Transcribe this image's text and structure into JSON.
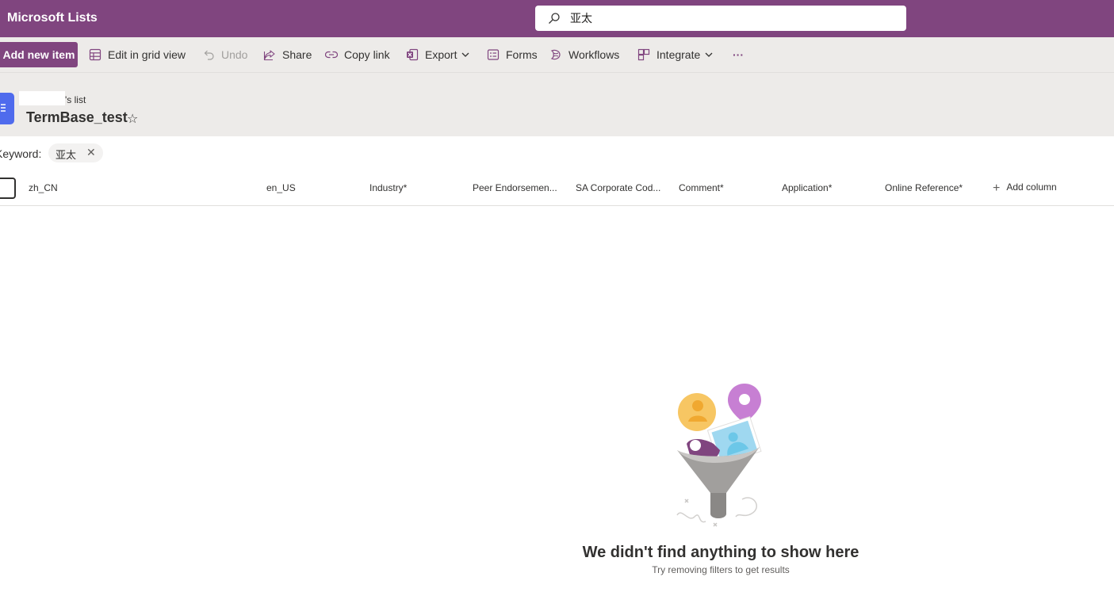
{
  "app": {
    "title": "Microsoft Lists"
  },
  "search": {
    "value": "亚太",
    "placeholder": ""
  },
  "commandbar": {
    "add_new_item": "Add new item",
    "edit_grid": "Edit in grid view",
    "undo": "Undo",
    "share": "Share",
    "copy_link": "Copy link",
    "export": "Export",
    "forms": "Forms",
    "workflows": "Workflows",
    "integrate": "Integrate",
    "more": "···"
  },
  "header": {
    "owner_suffix": "'s list",
    "title": "TermBase_test",
    "favorite_glyph": "☆"
  },
  "filter": {
    "label": "Keyword:",
    "value": "亚太",
    "remove_glyph": "✕"
  },
  "columns": [
    {
      "label": "zh_CN"
    },
    {
      "label": "en_US"
    },
    {
      "label": "Industry*"
    },
    {
      "label": "Peer Endorsemen..."
    },
    {
      "label": "SA Corporate Cod..."
    },
    {
      "label": "Comment*"
    },
    {
      "label": "Application*"
    },
    {
      "label": "Online Reference*"
    }
  ],
  "add_column": "Add column",
  "empty_state": {
    "title": "We didn't find anything to show here",
    "subtitle": "Try removing filters to get results"
  },
  "colors": {
    "brand": "#80457f",
    "command_bg": "#edebe9",
    "list_icon": "#4f6bed"
  }
}
